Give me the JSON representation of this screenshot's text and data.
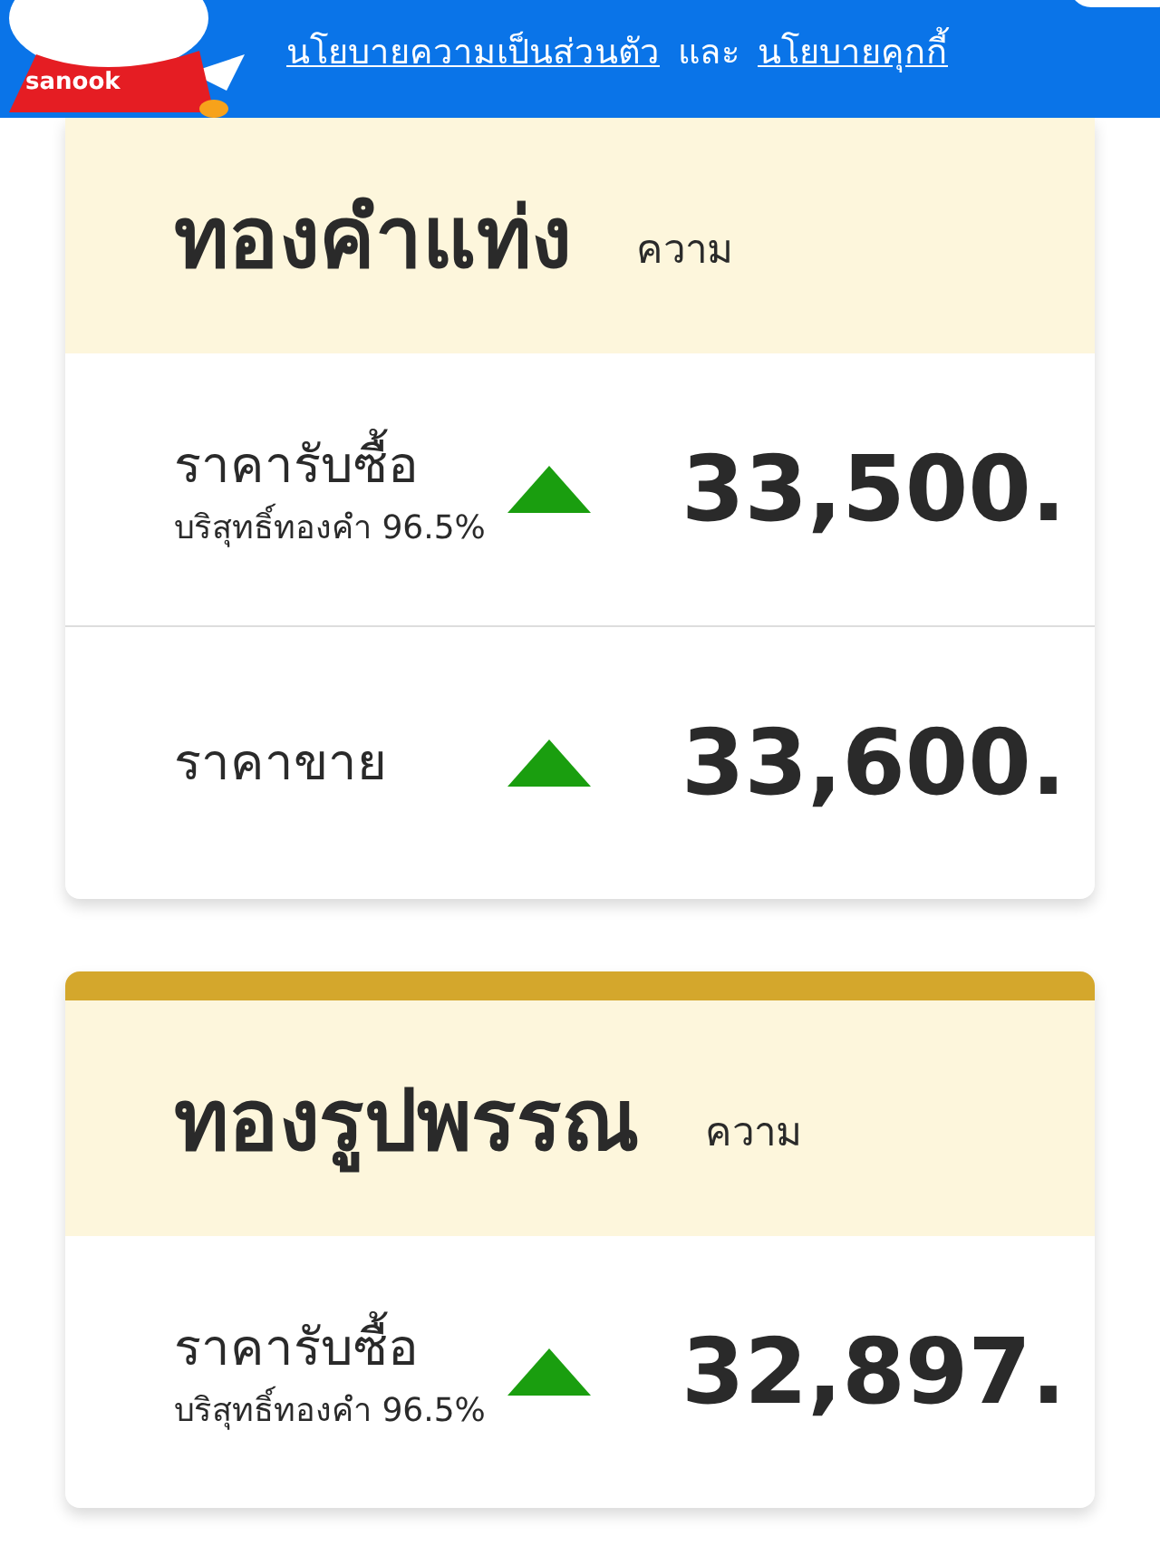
{
  "banner": {
    "mascot_label": "sanook",
    "links": [
      {
        "text": "นโยบายความเป็นส่วนตัว"
      },
      {
        "text": "นโยบายคุกกี้"
      }
    ],
    "joiner": "และ"
  },
  "cards": [
    {
      "title": "ทองคำแท่ง",
      "unit": "ความ",
      "gold_bar": false,
      "rows": [
        {
          "label": "ราคารับซื้อ",
          "sublabel": "บริสุทธิ์ทองคำ 96.5%",
          "rising": true,
          "price": "33,500."
        },
        {
          "label": "ราคาขาย",
          "rising": true,
          "price": "33,600."
        }
      ]
    },
    {
      "title": "ทองรูปพรรณ",
      "unit": "ความ",
      "gold_bar": true,
      "rows": [
        {
          "label": "ราคารับซื้อ",
          "sublabel": "บริสุทธิ์ทองคำ 96.5%",
          "rising": true,
          "price": "32,897."
        }
      ]
    }
  ]
}
